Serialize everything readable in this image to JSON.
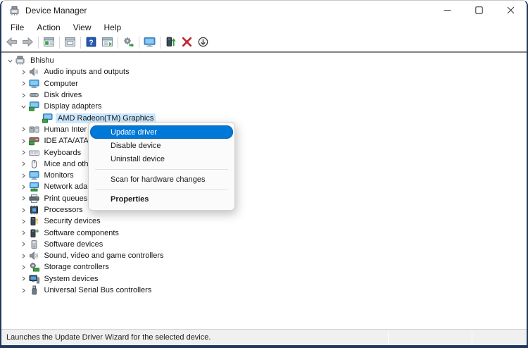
{
  "window": {
    "title": "Device Manager",
    "title_icon": "device-manager-icon",
    "controls": [
      {
        "name": "minimize",
        "icon": "minimize-icon"
      },
      {
        "name": "maximize",
        "icon": "maximize-icon"
      },
      {
        "name": "close",
        "icon": "close-icon"
      }
    ]
  },
  "menubar": {
    "items": [
      "File",
      "Action",
      "View",
      "Help"
    ]
  },
  "toolbar": {
    "items": [
      {
        "name": "back",
        "icon": "back-arrow-icon"
      },
      {
        "name": "forward",
        "icon": "forward-arrow-icon"
      },
      {
        "sep": true
      },
      {
        "name": "show-console-tree",
        "icon": "show-console-tree-icon"
      },
      {
        "sep": true
      },
      {
        "name": "properties-window",
        "icon": "properties-window-icon"
      },
      {
        "sep": true
      },
      {
        "name": "help",
        "icon": "help-icon"
      },
      {
        "name": "export-list",
        "icon": "export-list-icon"
      },
      {
        "sep": true
      },
      {
        "name": "scan-hardware-changes",
        "icon": "scan-hardware-changes-icon"
      },
      {
        "sep": true
      },
      {
        "name": "devices-view",
        "icon": "devices-view-icon"
      },
      {
        "sep": true
      },
      {
        "name": "update-driver",
        "icon": "update-driver-icon"
      },
      {
        "name": "uninstall-device",
        "icon": "uninstall-device-icon"
      },
      {
        "name": "disable-device",
        "icon": "disable-device-icon"
      }
    ]
  },
  "tree": {
    "items": [
      {
        "label": "Bhishu",
        "level": 0,
        "state": "expanded",
        "icon": "computer-icon"
      },
      {
        "label": "Audio inputs and outputs",
        "level": 1,
        "state": "collapsed",
        "icon": "speaker-icon"
      },
      {
        "label": "Computer",
        "level": 1,
        "state": "collapsed",
        "icon": "monitor-icon"
      },
      {
        "label": "Disk drives",
        "level": 1,
        "state": "collapsed",
        "icon": "disk-icon"
      },
      {
        "label": "Display adapters",
        "level": 1,
        "state": "expanded",
        "icon": "display-adapter-icon"
      },
      {
        "label": "AMD Radeon(TM) Graphics",
        "level": 2,
        "state": "leaf",
        "icon": "display-adapter-icon",
        "selected": true
      },
      {
        "label": "Human Inter",
        "level": 1,
        "state": "collapsed",
        "icon": "hid-icon"
      },
      {
        "label": "IDE ATA/ATA",
        "level": 1,
        "state": "collapsed",
        "icon": "ide-icon"
      },
      {
        "label": "Keyboards",
        "level": 1,
        "state": "collapsed",
        "icon": "keyboard-icon"
      },
      {
        "label": "Mice and oth",
        "level": 1,
        "state": "collapsed",
        "icon": "mouse-icon"
      },
      {
        "label": "Monitors",
        "level": 1,
        "state": "collapsed",
        "icon": "monitor-icon"
      },
      {
        "label": "Network ada",
        "level": 1,
        "state": "collapsed",
        "icon": "network-icon"
      },
      {
        "label": "Print queues",
        "level": 1,
        "state": "collapsed",
        "icon": "printer-icon"
      },
      {
        "label": "Processors",
        "level": 1,
        "state": "collapsed",
        "icon": "processor-icon"
      },
      {
        "label": "Security devices",
        "level": 1,
        "state": "collapsed",
        "icon": "security-icon"
      },
      {
        "label": "Software components",
        "level": 1,
        "state": "collapsed",
        "icon": "software-component-icon"
      },
      {
        "label": "Software devices",
        "level": 1,
        "state": "collapsed",
        "icon": "software-device-icon"
      },
      {
        "label": "Sound, video and game controllers",
        "level": 1,
        "state": "collapsed",
        "icon": "speaker-icon"
      },
      {
        "label": "Storage controllers",
        "level": 1,
        "state": "collapsed",
        "icon": "storage-icon"
      },
      {
        "label": "System devices",
        "level": 1,
        "state": "collapsed",
        "icon": "system-icon"
      },
      {
        "label": "Universal Serial Bus controllers",
        "level": 1,
        "state": "collapsed",
        "icon": "usb-icon"
      }
    ]
  },
  "context_menu": {
    "items": [
      {
        "label": "Update driver",
        "highlighted": true
      },
      {
        "label": "Disable device"
      },
      {
        "label": "Uninstall device"
      },
      {
        "separator": true
      },
      {
        "label": "Scan for hardware changes"
      },
      {
        "separator": true
      },
      {
        "label": "Properties",
        "bold": true
      }
    ]
  },
  "status_bar": {
    "text": "Launches the Update Driver Wizard for the selected device."
  },
  "colors": {
    "accent_blue": "#0078d7",
    "tree_selection": "#cce8ff",
    "window_border": "#22375c",
    "uninstall_red": "#c0272d",
    "help_blue": "#2458b3",
    "status_bg": "#f0f0f0"
  }
}
